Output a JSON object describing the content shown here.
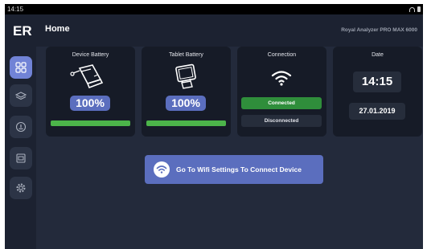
{
  "statusbar": {
    "time": "14:15"
  },
  "header": {
    "logo": "ER",
    "title": "Home",
    "app_name": "Royal Analyzer PRO MAX 6000"
  },
  "sidebar": {
    "items": [
      {
        "icon": "grid-icon",
        "active": true
      },
      {
        "icon": "layers-icon",
        "active": false
      },
      {
        "icon": "info-icon",
        "active": false
      },
      {
        "icon": "report-icon",
        "active": false
      },
      {
        "icon": "gear-icon",
        "active": false
      }
    ]
  },
  "cards": {
    "device_battery": {
      "title": "Device Battery",
      "icon": "device-icon",
      "value": "100%",
      "level": 1.0
    },
    "tablet_battery": {
      "title": "Tablet Battery",
      "icon": "tablet-icon",
      "value": "100%",
      "level": 1.0
    },
    "connection": {
      "title": "Connection",
      "icon": "wifi-icon",
      "connected_label": "Connected",
      "disconnected_label": "Disconnected"
    },
    "date": {
      "title": "Date",
      "time": "14:15",
      "date": "27.01.2019"
    }
  },
  "wifi_button": {
    "label": "Go To Wifi Settings To Connect Device",
    "icon": "wifi-icon"
  },
  "colors": {
    "accent": "#5b6ebe",
    "sidebar_active": "#7183d6",
    "connected": "#2f8e3b",
    "battery_fill": "#4cb44a",
    "background": "#232a3b"
  }
}
